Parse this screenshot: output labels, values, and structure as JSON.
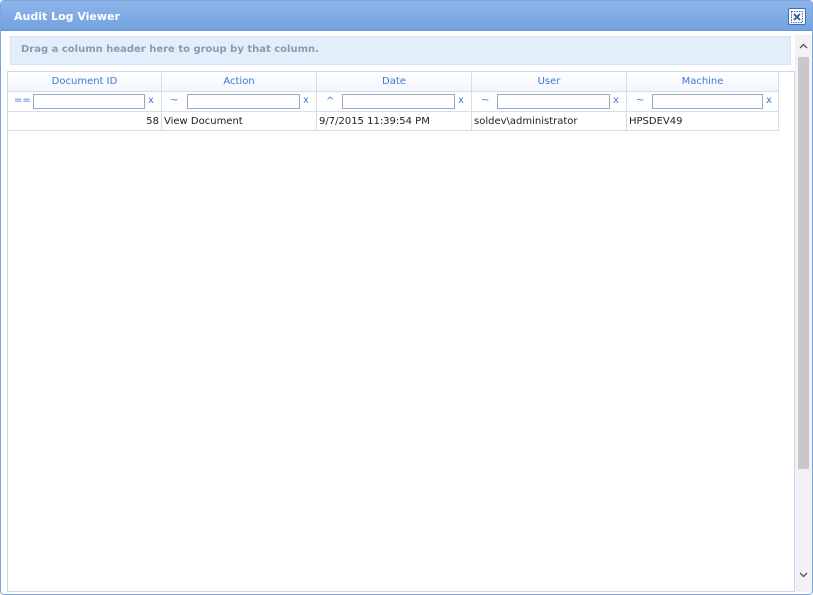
{
  "window": {
    "title": "Audit Log Viewer",
    "close_icon": "close-icon"
  },
  "group_panel": {
    "text": "Drag a column header here to group by that column."
  },
  "grid": {
    "columns": [
      {
        "label": "Document ID",
        "filter_operator": "==",
        "filter_value": "",
        "clear_label": "x"
      },
      {
        "label": "Action",
        "filter_operator": "~",
        "filter_value": "",
        "clear_label": "x"
      },
      {
        "label": "Date",
        "filter_operator": "^",
        "filter_value": "",
        "clear_label": "x"
      },
      {
        "label": "User",
        "filter_operator": "~",
        "filter_value": "",
        "clear_label": "x"
      },
      {
        "label": "Machine",
        "filter_operator": "~",
        "filter_value": "",
        "clear_label": "x"
      }
    ],
    "rows": [
      [
        "58",
        "View Document",
        "9/7/2015 11:39:54 PM",
        "soldev\\administrator",
        "HPSDEV49"
      ]
    ]
  },
  "scrollbar": {
    "up_icon": "chevron-up-icon",
    "down_icon": "chevron-down-icon"
  },
  "colors": {
    "titlebar": "#7ea9e3",
    "header_text": "#3b7ad6",
    "group_panel": "#e2effb"
  }
}
